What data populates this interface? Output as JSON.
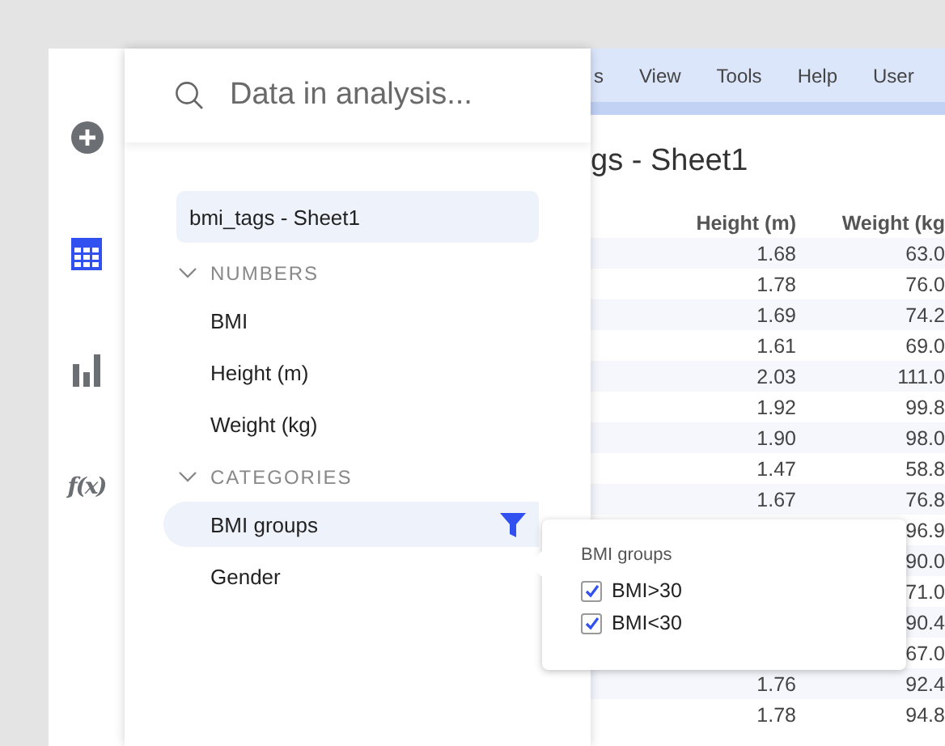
{
  "toolbar": {
    "items": [
      {
        "kind": "add",
        "selected": false
      },
      {
        "kind": "table",
        "selected": true
      },
      {
        "kind": "chart",
        "selected": false
      },
      {
        "kind": "formula",
        "label": "f(x)",
        "selected": false
      }
    ]
  },
  "data_panel": {
    "search": {
      "placeholder": "Data in analysis..."
    },
    "source": "bmi_tags - Sheet1",
    "sections": [
      {
        "title": "NUMBERS",
        "expanded": true,
        "items": [
          {
            "label": "BMI",
            "selected": false,
            "filtered": false
          },
          {
            "label": "Height (m)",
            "selected": false,
            "filtered": false
          },
          {
            "label": "Weight (kg)",
            "selected": false,
            "filtered": false
          }
        ]
      },
      {
        "title": "CATEGORIES",
        "expanded": true,
        "items": [
          {
            "label": "BMI groups",
            "selected": true,
            "filtered": true
          },
          {
            "label": "Gender",
            "selected": false,
            "filtered": false
          }
        ]
      }
    ]
  },
  "menu": [
    "s",
    "View",
    "Tools",
    "Help",
    "User"
  ],
  "table": {
    "title": "gs - Sheet1",
    "columns": [
      "Height (m)",
      "Weight (kg"
    ],
    "rows": [
      [
        "1.68",
        "63.0"
      ],
      [
        "1.78",
        "76.0"
      ],
      [
        "1.69",
        "74.2"
      ],
      [
        "1.61",
        "69.0"
      ],
      [
        "2.03",
        "111.0"
      ],
      [
        "1.92",
        "99.8"
      ],
      [
        "1.90",
        "98.0"
      ],
      [
        "1.47",
        "58.8"
      ],
      [
        "1.67",
        "76.8"
      ],
      [
        null,
        "96.9"
      ],
      [
        null,
        "90.0"
      ],
      [
        null,
        "71.0"
      ],
      [
        null,
        "90.4"
      ],
      [
        null,
        "67.0"
      ],
      [
        "1.76",
        "92.4"
      ],
      [
        "1.78",
        "94.8"
      ]
    ]
  },
  "filter_popup": {
    "title": "BMI groups",
    "options": [
      {
        "label": "BMI>30",
        "checked": true
      },
      {
        "label": "BMI<30",
        "checked": true
      }
    ]
  }
}
